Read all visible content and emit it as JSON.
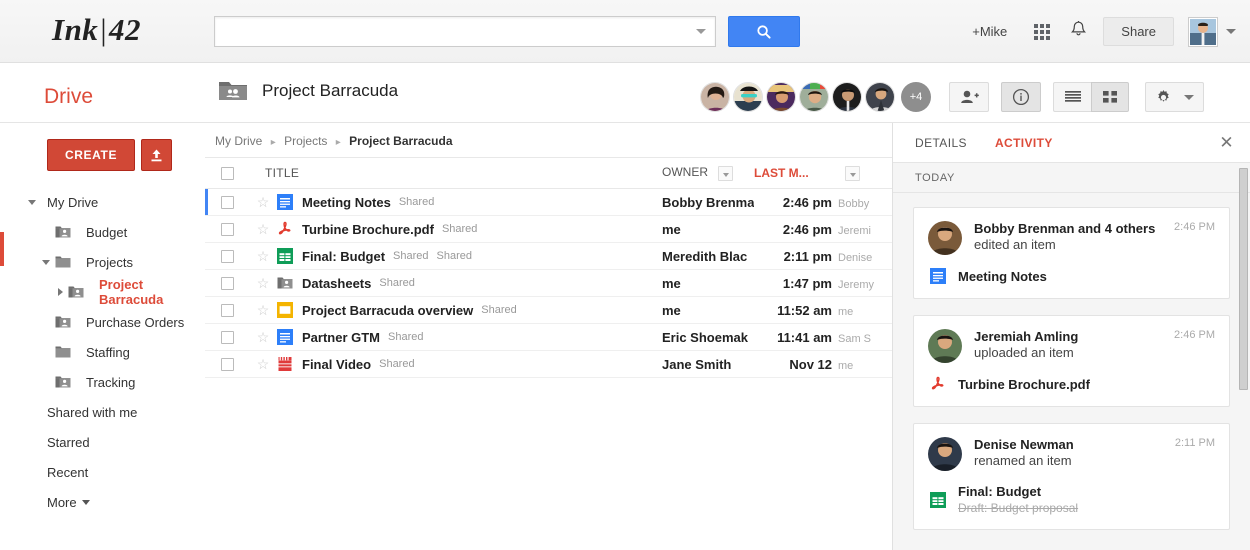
{
  "topbar": {
    "logo_main": "Ink",
    "logo_bar": "|",
    "logo_num": "42",
    "search_value": "",
    "search_placeholder": "",
    "search_button_icon": "search-icon",
    "plus_name": "+Mike",
    "apps_icon": "apps-grid-icon",
    "bell_icon": "bell-icon",
    "share_label": "Share",
    "avatar_icon": "user-avatar",
    "caret_icon": "chevron-down-icon"
  },
  "subbar": {
    "drive_label": "Drive",
    "folder_icon": "shared-folder-icon",
    "folder_title": "Project Barracuda",
    "collaborator_overflow": "+4",
    "add_person_icon": "person-add-icon",
    "info_icon": "info-icon",
    "list_view_icon": "list-view-icon",
    "grid_view_icon": "grid-view-icon",
    "settings_icon": "gear-icon",
    "settings_caret": "chevron-down-icon",
    "collaborators": [
      {
        "name": "collaborator-1",
        "color": "#b08a7c"
      },
      {
        "name": "collaborator-2",
        "color": "#2f4a66"
      },
      {
        "name": "collaborator-3",
        "color": "#5a3f70"
      },
      {
        "name": "collaborator-4",
        "color": "#6d7f6a"
      },
      {
        "name": "collaborator-5",
        "color": "#2b2b2b"
      },
      {
        "name": "collaborator-6",
        "color": "#4a4a52"
      }
    ]
  },
  "sidebar": {
    "create_label": "CREATE",
    "upload_icon": "upload-icon",
    "items": [
      {
        "label": "My Drive",
        "level": 0,
        "toggle": "down",
        "icon": "none",
        "selected": false
      },
      {
        "label": "Budget",
        "level": 1,
        "toggle": "none",
        "icon": "shared-folder",
        "selected": false
      },
      {
        "label": "Projects",
        "level": 1,
        "toggle": "down",
        "icon": "folder",
        "selected": false
      },
      {
        "label": "Project Barracuda",
        "level": 2,
        "toggle": "right",
        "icon": "shared-folder",
        "selected": true
      },
      {
        "label": "Purchase Orders",
        "level": 1,
        "toggle": "none",
        "icon": "shared-folder",
        "selected": false
      },
      {
        "label": "Staffing",
        "level": 1,
        "toggle": "none",
        "icon": "folder",
        "selected": false
      },
      {
        "label": "Tracking",
        "level": 1,
        "toggle": "none",
        "icon": "shared-folder",
        "selected": false
      },
      {
        "label": "Shared with me",
        "level": 0,
        "toggle": "none",
        "icon": "none",
        "selected": false
      },
      {
        "label": "Starred",
        "level": 0,
        "toggle": "none",
        "icon": "none",
        "selected": false
      },
      {
        "label": "Recent",
        "level": 0,
        "toggle": "none",
        "icon": "none",
        "selected": false
      },
      {
        "label": "More",
        "level": 0,
        "toggle": "none",
        "icon": "none",
        "selected": false,
        "caret": true
      }
    ]
  },
  "filelist": {
    "breadcrumb": [
      "My Drive",
      "Projects",
      "Project Barracuda"
    ],
    "columns": {
      "title": "TITLE",
      "owner": "OWNER",
      "modified": "LAST M..."
    },
    "rows": [
      {
        "name": "Meeting Notes",
        "shared": "Shared",
        "shared2": "",
        "icon": "google-doc",
        "owner": "Bobby Brenma",
        "time": "2:46 pm",
        "by": "Bobby",
        "selected": true
      },
      {
        "name": "Turbine Brochure.pdf",
        "shared": "Shared",
        "shared2": "",
        "icon": "pdf",
        "owner": "me",
        "time": "2:46 pm",
        "by": "Jeremi",
        "selected": false
      },
      {
        "name": "Final: Budget",
        "shared": "Shared",
        "shared2": "Shared",
        "icon": "google-sheet",
        "owner": "Meredith Blac",
        "time": "2:11 pm",
        "by": "Denise",
        "selected": false
      },
      {
        "name": "Datasheets",
        "shared": "Shared",
        "shared2": "",
        "icon": "shared-folder",
        "owner": "me",
        "time": "1:47 pm",
        "by": "Jeremy",
        "selected": false
      },
      {
        "name": "Project Barracuda overview",
        "shared": "Shared",
        "shared2": "",
        "icon": "google-slide",
        "owner": "me",
        "time": "11:52 am",
        "by": "me",
        "selected": false
      },
      {
        "name": "Partner GTM",
        "shared": "Shared",
        "shared2": "",
        "icon": "google-doc",
        "owner": "Eric Shoemak",
        "time": "11:41 am",
        "by": "Sam S",
        "selected": false
      },
      {
        "name": "Final Video",
        "shared": "Shared",
        "shared2": "",
        "icon": "video",
        "owner": "Jane Smith",
        "time": "Nov 12",
        "by": "me",
        "selected": false
      }
    ]
  },
  "rightpanel": {
    "tab_details": "DETAILS",
    "tab_activity": "ACTIVITY",
    "close_icon": "close-icon",
    "section_label": "TODAY",
    "activities": [
      {
        "who": "Bobby Brenman and 4 others",
        "action": "edited an item",
        "time": "2:46 PM",
        "file": "Meeting Notes",
        "file_icon": "google-doc",
        "old_name": "",
        "avatar_color": "#7a5a3a"
      },
      {
        "who": "Jeremiah Amling",
        "action": "uploaded an item",
        "time": "2:46 PM",
        "file": "Turbine Brochure.pdf",
        "file_icon": "pdf",
        "old_name": "",
        "avatar_color": "#5f7a55"
      },
      {
        "who": "Denise Newman",
        "action": "renamed an item",
        "time": "2:11 PM",
        "file": "Final: Budget",
        "file_icon": "google-sheet",
        "old_name": "Draft: Budget proposal",
        "avatar_color": "#2f3a4a"
      }
    ]
  },
  "colors": {
    "brand_red": "#dd4b39",
    "accent_blue": "#4285f4",
    "doc_blue": "#2d7ff9",
    "sheet_green": "#0f9d58",
    "slide_orange": "#f4b400",
    "pdf_red": "#e23b2e",
    "video_red": "#e03a3a",
    "folder_gray": "#7b7b7b"
  }
}
